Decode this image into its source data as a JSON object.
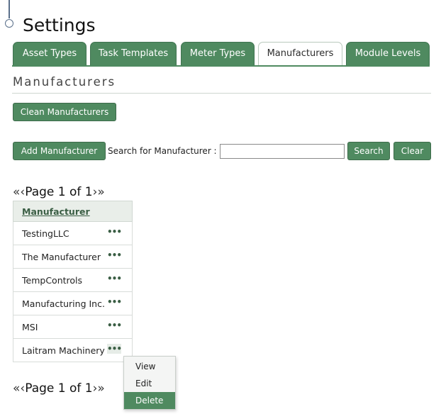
{
  "page": {
    "title": "Settings"
  },
  "tabs": [
    {
      "label": "Asset Types",
      "active": false
    },
    {
      "label": "Task Templates",
      "active": false
    },
    {
      "label": "Meter Types",
      "active": false
    },
    {
      "label": "Manufacturers",
      "active": true
    },
    {
      "label": "Module Levels",
      "active": false
    }
  ],
  "section": {
    "heading": "Manufacturers",
    "clean_button": "Clean Manufacturers",
    "add_button": "Add Manufacturer",
    "search_label": "Search for Manufacturer :",
    "search_value": "",
    "search_button": "Search",
    "clear_button": "Clear"
  },
  "pager": {
    "first_icon": "«",
    "prev_icon": "‹",
    "text": "Page 1 of 1",
    "next_icon": "›",
    "last_icon": "»"
  },
  "table": {
    "column_header": "Manufacturer",
    "rows": [
      {
        "name": "TestingLLC",
        "actions": "•••"
      },
      {
        "name": "The Manufacturer",
        "actions": "•••"
      },
      {
        "name": "TempControls",
        "actions": "•••"
      },
      {
        "name": "Manufacturing Inc.",
        "actions": "•••"
      },
      {
        "name": "MSI",
        "actions": "•••"
      },
      {
        "name": "Laitram Machinery",
        "actions": "•••"
      }
    ]
  },
  "context_menu": {
    "items": [
      "View",
      "Edit",
      "Delete"
    ],
    "highlighted": "Delete"
  },
  "colors": {
    "accent": "#4f8a60",
    "header_bg": "#e9eee9"
  }
}
